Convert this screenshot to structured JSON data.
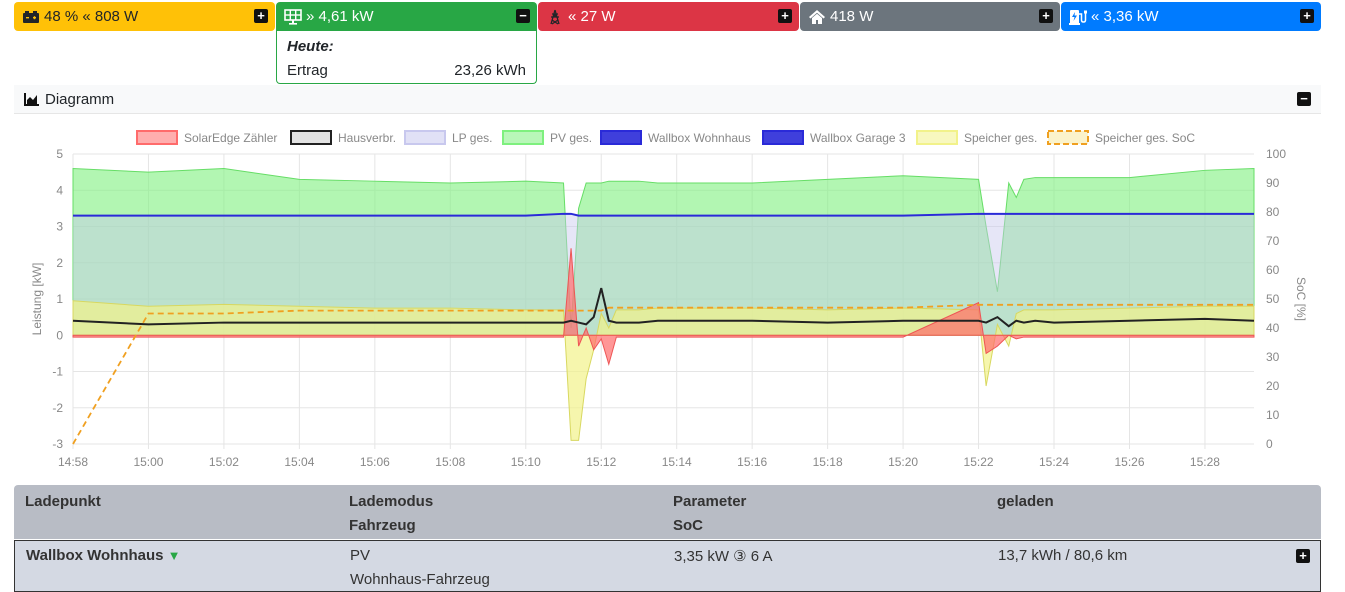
{
  "tiles": {
    "battery": {
      "text": "48 % « 808 W",
      "icon": "car-battery-icon",
      "toggle": "+"
    },
    "pv": {
      "text": "» 4,61 kW",
      "icon": "solar-panel-icon",
      "toggle": "−"
    },
    "grid": {
      "text": "« 27 W",
      "icon": "power-pylon-icon",
      "toggle": "+"
    },
    "house": {
      "text": "418 W",
      "icon": "house-icon",
      "toggle": "+"
    },
    "chargepoint": {
      "text": "« 3,36 kW",
      "icon": "charging-station-icon",
      "toggle": "+"
    }
  },
  "pv_detail": {
    "heading": "Heute:",
    "label": "Ertrag",
    "value": "23,26 kWh"
  },
  "diagram": {
    "title": "Diagramm",
    "toggle": "−"
  },
  "chart_data": {
    "type": "area",
    "legend_position": "top",
    "grid": true,
    "legend": [
      "SolarEdge Zähler",
      "Hausverbr.",
      "LP ges.",
      "PV ges.",
      "Wallbox Wohnhaus",
      "Wallbox Garage 3",
      "Speicher ges.",
      "Speicher ges. SoC"
    ],
    "colors": {
      "SolarEdge Zähler": "#ff6b6b",
      "Hausverbr.": "#222222",
      "LP ges.": "#c8c8ee",
      "PV ges.": "#7ef07e",
      "Wallbox Wohnhaus": "#2a2ad8",
      "Wallbox Garage 3": "#2a2ad8",
      "Speicher ges.": "#f2f28a",
      "Speicher ges. SoC": "#f0a020"
    },
    "ylabel": "Leistung [kW]",
    "ylabel_right": "SoC [%]",
    "ylim": [
      -3,
      5
    ],
    "ylim_right": [
      0,
      100
    ],
    "yticks": [
      "5",
      "4",
      "3",
      "2",
      "1",
      "0",
      "-1",
      "-2",
      "-3"
    ],
    "yticks_right": [
      "100",
      "90",
      "80",
      "70",
      "60",
      "50",
      "40",
      "30",
      "20",
      "10",
      "0"
    ],
    "xticks": [
      "14:58",
      "15:00",
      "15:02",
      "15:04",
      "15:06",
      "15:08",
      "15:10",
      "15:12",
      "15:14",
      "15:16",
      "15:18",
      "15:20",
      "15:22",
      "15:24",
      "15:26",
      "15:28"
    ],
    "x_minutes": [
      0,
      2,
      4,
      6,
      8,
      10,
      12,
      13,
      13.2,
      13.4,
      13.6,
      13.8,
      14,
      14.2,
      14.4,
      14.6,
      14.8,
      15,
      15.5,
      16,
      18,
      20,
      22,
      24,
      24.2,
      24.5,
      24.8,
      25,
      25.2,
      25.5,
      26,
      28,
      30,
      31.3
    ],
    "series": [
      {
        "name": "PV ges.",
        "values": [
          4.6,
          4.5,
          4.6,
          4.3,
          4.25,
          4.2,
          4.25,
          4.2,
          0.2,
          3.5,
          4.2,
          4.2,
          4.2,
          4.25,
          4.25,
          4.25,
          4.25,
          4.25,
          4.2,
          4.2,
          4.2,
          4.3,
          4.4,
          4.3,
          3.0,
          1.2,
          4.2,
          3.8,
          4.3,
          4.35,
          4.35,
          4.35,
          4.55,
          4.6
        ]
      },
      {
        "name": "Wallbox Wohnhaus",
        "values": [
          3.3,
          3.3,
          3.3,
          3.3,
          3.3,
          3.3,
          3.3,
          3.35,
          3.35,
          3.3,
          3.3,
          3.3,
          3.3,
          3.3,
          3.3,
          3.3,
          3.3,
          3.3,
          3.3,
          3.3,
          3.3,
          3.3,
          3.3,
          3.35,
          3.35,
          3.35,
          3.35,
          3.35,
          3.35,
          3.35,
          3.35,
          3.35,
          3.35,
          3.35
        ]
      },
      {
        "name": "Hausverbr.",
        "values": [
          0.4,
          0.3,
          0.35,
          0.35,
          0.35,
          0.35,
          0.35,
          0.35,
          0.4,
          0.35,
          0.3,
          0.5,
          1.3,
          0.4,
          0.35,
          0.35,
          0.35,
          0.35,
          0.4,
          0.4,
          0.4,
          0.35,
          0.4,
          0.4,
          0.35,
          0.5,
          0.25,
          0.4,
          0.35,
          0.4,
          0.35,
          0.4,
          0.45,
          0.4
        ]
      },
      {
        "name": "SolarEdge Zähler",
        "values": [
          -0.05,
          -0.05,
          -0.05,
          -0.05,
          -0.05,
          -0.05,
          -0.05,
          -0.05,
          2.4,
          -0.3,
          0.2,
          -0.4,
          -0.1,
          -0.8,
          -0.05,
          -0.05,
          -0.05,
          -0.05,
          -0.05,
          -0.05,
          -0.05,
          -0.05,
          -0.05,
          0.9,
          -0.5,
          -0.3,
          0.0,
          -0.1,
          -0.05,
          -0.05,
          -0.05,
          -0.05,
          -0.05,
          -0.05
        ]
      },
      {
        "name": "Speicher ges.",
        "values": [
          0.95,
          0.8,
          0.85,
          0.8,
          0.75,
          0.75,
          0.7,
          0.7,
          -2.9,
          -2.9,
          -1.2,
          -0.4,
          0.6,
          0.2,
          0.7,
          0.7,
          0.7,
          0.7,
          0.75,
          0.75,
          0.75,
          0.7,
          0.75,
          0.7,
          -1.4,
          0.3,
          -0.3,
          0.6,
          0.7,
          0.7,
          0.7,
          0.75,
          0.8,
          0.8
        ]
      },
      {
        "name": "Speicher ges. SoC",
        "values": [
          0,
          45,
          45,
          46,
          46,
          46,
          46,
          46,
          46,
          46,
          46,
          46,
          46,
          47,
          47,
          47,
          47,
          47,
          47,
          47,
          47,
          47,
          47,
          48,
          48,
          48,
          48,
          48,
          48,
          48,
          48,
          48,
          48,
          48
        ]
      }
    ]
  },
  "table": {
    "headers": [
      [
        "Ladepunkt",
        ""
      ],
      [
        "Lademodus",
        "Fahrzeug"
      ],
      [
        "Parameter",
        "SoC"
      ],
      [
        "geladen",
        ""
      ]
    ],
    "rows": [
      {
        "name": "Wallbox Wohnhaus",
        "plug": "⏚",
        "mode": "PV",
        "vehicle": "Wohnhaus-Fahrzeug",
        "params": "3,35 kW ③ 6 A",
        "charged": "13,7 kWh / 80,6 km",
        "toggle": "+"
      }
    ]
  }
}
